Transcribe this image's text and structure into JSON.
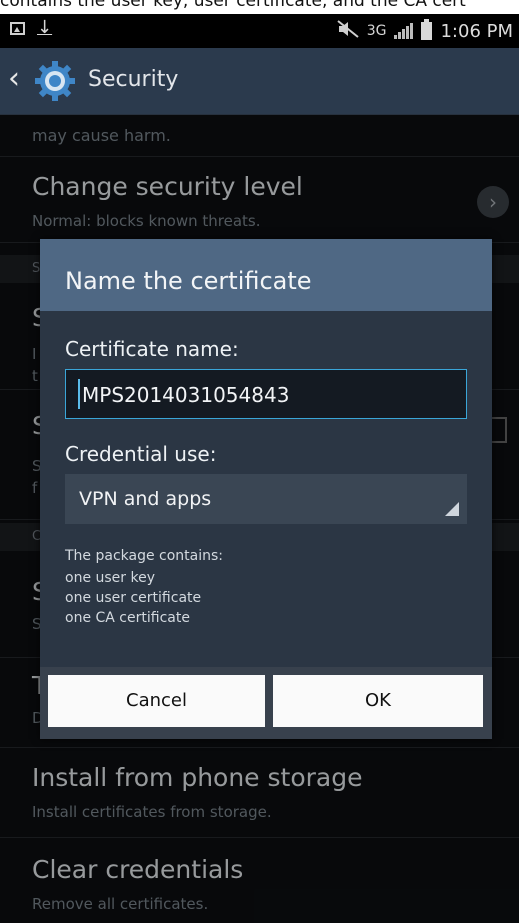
{
  "caption": "contains the user key, user certificate, and the CA cert",
  "status_bar": {
    "network": "3G",
    "time": "1:06 PM"
  },
  "action_bar": {
    "title": "Security",
    "icons": [
      "back-chevron-icon",
      "gear-icon"
    ]
  },
  "list": {
    "items": [
      {
        "title": "",
        "subtitle": "may cause harm."
      },
      {
        "title": "Change security level",
        "subtitle": "Normal: blocks known threats."
      },
      {
        "section": "S"
      },
      {
        "title": "S",
        "subtitle": "I",
        "subtitle2": "t"
      },
      {
        "title": "S",
        "subtitle": "S",
        "subtitle2": "f"
      },
      {
        "section": "C"
      },
      {
        "title": "S",
        "subtitle": "S"
      },
      {
        "title": "T",
        "subtitle": "D"
      },
      {
        "title": "Install from phone storage",
        "subtitle": "Install certificates from storage."
      },
      {
        "title": "Clear credentials",
        "subtitle": "Remove all certificates."
      }
    ]
  },
  "dialog": {
    "title": "Name the certificate",
    "name_label": "Certificate name:",
    "name_value": "MPS2014031054843",
    "use_label": "Credential use:",
    "use_value": "VPN and apps",
    "package_heading": "The package contains:",
    "package_items": [
      "one user key",
      "one user certificate",
      "one CA certificate"
    ],
    "cancel_label": "Cancel",
    "ok_label": "OK"
  },
  "colors": {
    "action_bar": "#2b3a4d",
    "dialog_header": "#4f6884",
    "dialog_body": "#2b3644",
    "input_focus": "#3aa6d8"
  }
}
